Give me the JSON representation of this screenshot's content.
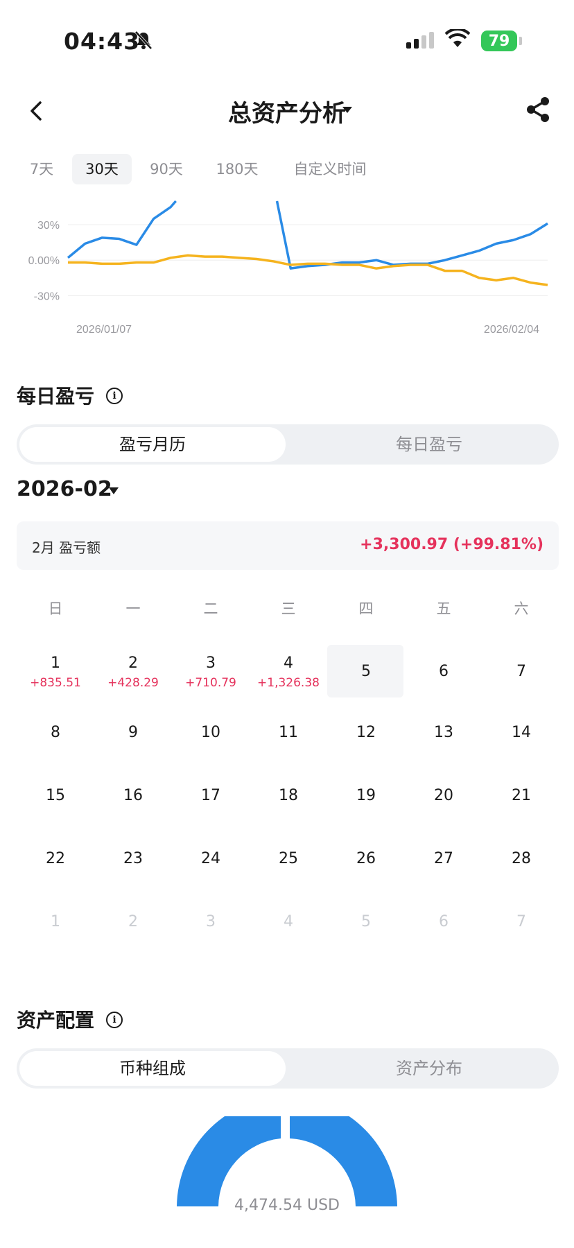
{
  "status_bar": {
    "time": "04:43",
    "battery": "79"
  },
  "header": {
    "title": "总资产分析"
  },
  "range_tabs": [
    {
      "label": "7天",
      "active": false
    },
    {
      "label": "30天",
      "active": true
    },
    {
      "label": "90天",
      "active": false
    },
    {
      "label": "180天",
      "active": false
    },
    {
      "label": "自定义时间",
      "active": false
    }
  ],
  "chart_data": {
    "type": "line",
    "yticks": [
      "30%",
      "0.00%",
      "-30%"
    ],
    "x_start_label": "2026/01/07",
    "x_end_label": "2026/02/04",
    "ylim": [
      -30,
      30
    ],
    "colors": {
      "blue": "#2a8be6",
      "yellow": "#f5b31e"
    },
    "series": [
      {
        "color": "blue",
        "segments": [
          [
            [
              0,
              2
            ],
            [
              1,
              14
            ],
            [
              2,
              19
            ],
            [
              3,
              18
            ],
            [
              4,
              13
            ],
            [
              5,
              35
            ],
            [
              6,
              45
            ],
            [
              6.3,
              50
            ]
          ],
          [
            [
              12.2,
              50
            ],
            [
              13,
              -7
            ],
            [
              14,
              -5
            ],
            [
              15,
              -4
            ],
            [
              16,
              -2
            ],
            [
              17,
              -2
            ],
            [
              18,
              0
            ],
            [
              19,
              -4
            ],
            [
              20,
              -3
            ],
            [
              21,
              -3
            ],
            [
              22,
              0
            ],
            [
              23,
              4
            ],
            [
              24,
              8
            ],
            [
              25,
              14
            ],
            [
              26,
              17
            ],
            [
              27,
              22
            ],
            [
              28,
              31
            ]
          ]
        ]
      },
      {
        "color": "yellow",
        "segments": [
          [
            [
              0,
              -2
            ],
            [
              1,
              -2
            ],
            [
              2,
              -3
            ],
            [
              3,
              -3
            ],
            [
              4,
              -2
            ],
            [
              5,
              -2
            ],
            [
              6,
              2
            ],
            [
              7,
              4
            ],
            [
              8,
              3
            ],
            [
              9,
              3
            ],
            [
              10,
              2
            ],
            [
              11,
              1
            ],
            [
              12,
              -1
            ],
            [
              13,
              -4
            ],
            [
              14,
              -3
            ],
            [
              15,
              -3
            ],
            [
              16,
              -4
            ],
            [
              17,
              -4
            ],
            [
              18,
              -7
            ],
            [
              19,
              -5
            ],
            [
              20,
              -4
            ],
            [
              21,
              -4
            ],
            [
              22,
              -9
            ],
            [
              23,
              -9
            ],
            [
              24,
              -15
            ],
            [
              25,
              -17
            ],
            [
              26,
              -15
            ],
            [
              27,
              -19
            ],
            [
              28,
              -21
            ]
          ]
        ]
      }
    ]
  },
  "daily_pl": {
    "title": "每日盈亏",
    "info_icon": "i",
    "tabs": [
      "盈亏月历",
      "每日盈亏"
    ],
    "month": "2026-02",
    "summary_label": "2月 盈亏额",
    "summary_value": "+3,300.97 (+99.81%)",
    "weekdays": [
      "日",
      "一",
      "二",
      "三",
      "四",
      "五",
      "六"
    ],
    "weeks": [
      [
        {
          "d": "1",
          "pl": "+835.51"
        },
        {
          "d": "2",
          "pl": "+428.29"
        },
        {
          "d": "3",
          "pl": "+710.79"
        },
        {
          "d": "4",
          "pl": "+1,326.38"
        },
        {
          "d": "5",
          "pl": ""
        },
        {
          "d": "6",
          "pl": ""
        },
        {
          "d": "7",
          "pl": ""
        }
      ],
      [
        {
          "d": "8"
        },
        {
          "d": "9"
        },
        {
          "d": "10"
        },
        {
          "d": "11"
        },
        {
          "d": "12"
        },
        {
          "d": "13"
        },
        {
          "d": "14"
        }
      ],
      [
        {
          "d": "15"
        },
        {
          "d": "16"
        },
        {
          "d": "17"
        },
        {
          "d": "18"
        },
        {
          "d": "19"
        },
        {
          "d": "20"
        },
        {
          "d": "21"
        }
      ],
      [
        {
          "d": "22"
        },
        {
          "d": "23"
        },
        {
          "d": "24"
        },
        {
          "d": "25"
        },
        {
          "d": "26"
        },
        {
          "d": "27"
        },
        {
          "d": "28"
        }
      ],
      [
        {
          "d": "1",
          "next": true
        },
        {
          "d": "2",
          "next": true
        },
        {
          "d": "3",
          "next": true
        },
        {
          "d": "4",
          "next": true
        },
        {
          "d": "5",
          "next": true
        },
        {
          "d": "6",
          "next": true
        },
        {
          "d": "7",
          "next": true
        }
      ]
    ]
  },
  "allocation": {
    "title": "资产配置",
    "info_icon": "i",
    "tabs": [
      "币种组成",
      "资产分布"
    ],
    "donut_label": "4,474.54 USD"
  }
}
